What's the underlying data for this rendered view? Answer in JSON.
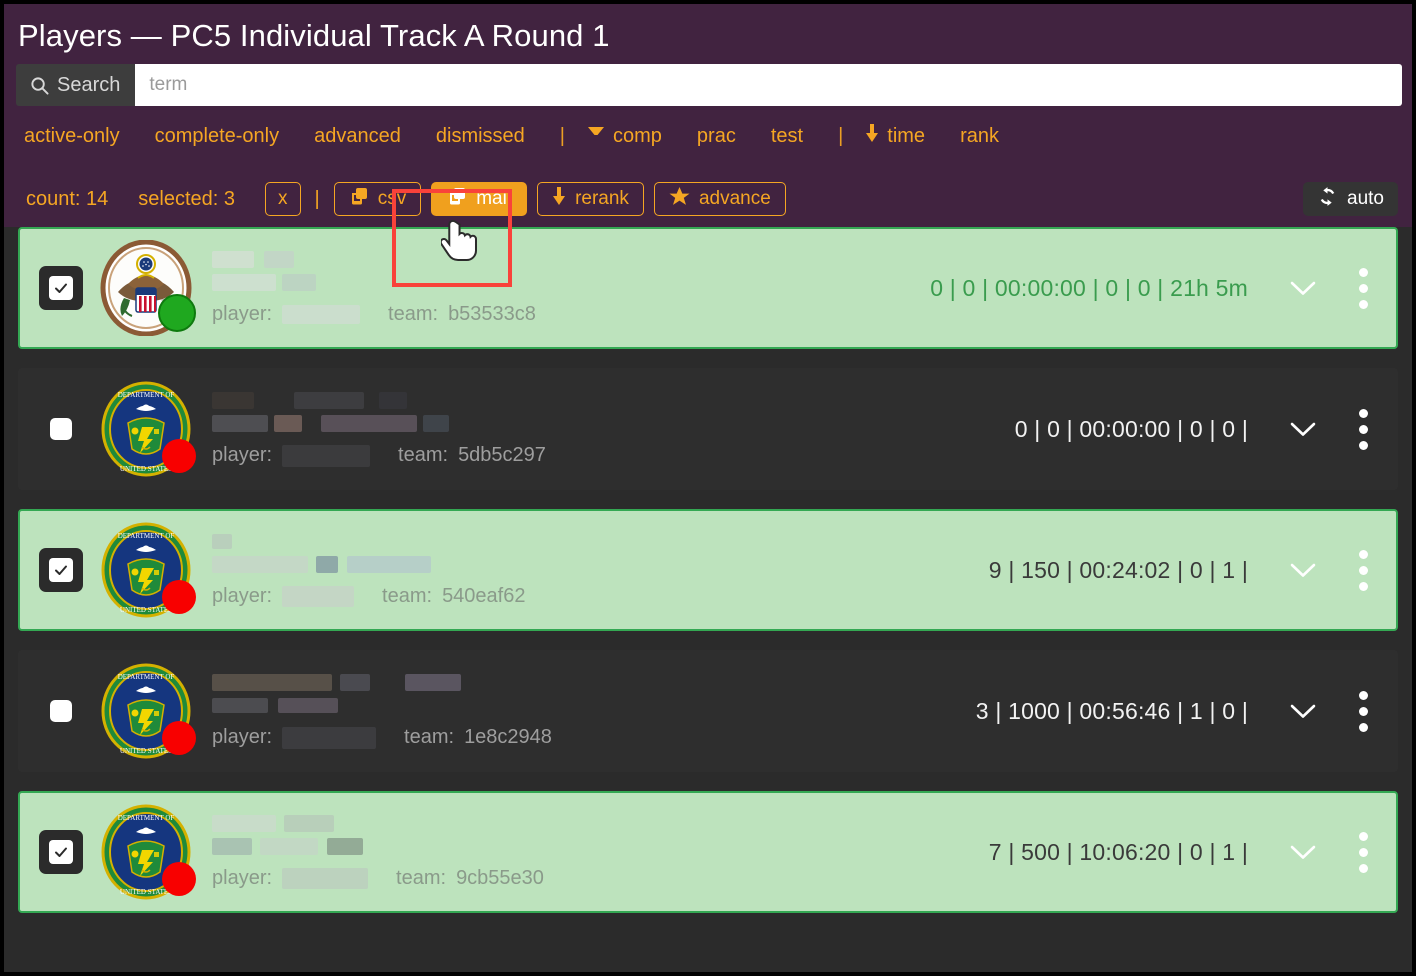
{
  "header": {
    "title": "Players — PC5 Individual Track A Round 1",
    "search": {
      "button_label": "Search",
      "icon": "search-icon",
      "placeholder": "term",
      "value": ""
    },
    "filters": [
      {
        "label": "active-only",
        "icon": null
      },
      {
        "label": "complete-only",
        "icon": null
      },
      {
        "label": "advanced",
        "icon": null
      },
      {
        "label": "dismissed",
        "icon": null
      },
      {
        "label": "|",
        "icon": "divider"
      },
      {
        "label": "comp",
        "icon": "filter-funnel-icon"
      },
      {
        "label": "prac",
        "icon": null
      },
      {
        "label": "test",
        "icon": null
      },
      {
        "label": "|",
        "icon": "divider"
      },
      {
        "label": "time",
        "icon": "arrow-down-icon"
      },
      {
        "label": "rank",
        "icon": null
      }
    ]
  },
  "toolbar": {
    "count_label": "count: 14",
    "selected_label": "selected: 3",
    "clear_label": "x",
    "divider": "|",
    "csv_label": "csv",
    "mail_label": "mail",
    "rerank_label": "rerank",
    "advance_label": "advance",
    "auto_label": "auto",
    "accent_color": "#f5a623",
    "mail_button_bg": "#f0a01e",
    "highlight_color": "#f9423a"
  },
  "rows": [
    {
      "selected": true,
      "checkbox_state": "checked",
      "emblem": "great-seal-icon",
      "status": "online",
      "status_color": "#1fa81f",
      "player_label": "player:",
      "team_label": "team:",
      "team_id": "b53533c8",
      "stats": "0 | 0 | 00:00:00 | 0 | 0 | 21h 5m",
      "stats_tone": "green"
    },
    {
      "selected": false,
      "checkbox_state": "unchecked",
      "emblem": "doe-seal-icon",
      "status": "offline",
      "status_color": "#f80000",
      "player_label": "player:",
      "team_label": "team:",
      "team_id": "5db5c297",
      "stats": "0 | 0 | 00:00:00 | 0 | 0 |",
      "stats_tone": "white"
    },
    {
      "selected": true,
      "checkbox_state": "checked",
      "emblem": "doe-seal-icon",
      "status": "offline",
      "status_color": "#f80000",
      "player_label": "player:",
      "team_label": "team:",
      "team_id": "540eaf62",
      "stats": "9 | 150 | 00:24:02 | 0 | 1 |",
      "stats_tone": "dark"
    },
    {
      "selected": false,
      "checkbox_state": "unchecked",
      "emblem": "doe-seal-icon",
      "status": "offline",
      "status_color": "#f80000",
      "player_label": "player:",
      "team_label": "team:",
      "team_id": "1e8c2948",
      "stats": "3 | 1000 | 00:56:46 | 1 | 0 |",
      "stats_tone": "white"
    },
    {
      "selected": true,
      "checkbox_state": "checked",
      "emblem": "doe-seal-icon",
      "status": "offline",
      "status_color": "#f80000",
      "player_label": "player:",
      "team_label": "team:",
      "team_id": "9cb55e30",
      "stats": "7 | 500 | 10:06:20 | 0 | 1 |",
      "stats_tone": "dark"
    }
  ]
}
